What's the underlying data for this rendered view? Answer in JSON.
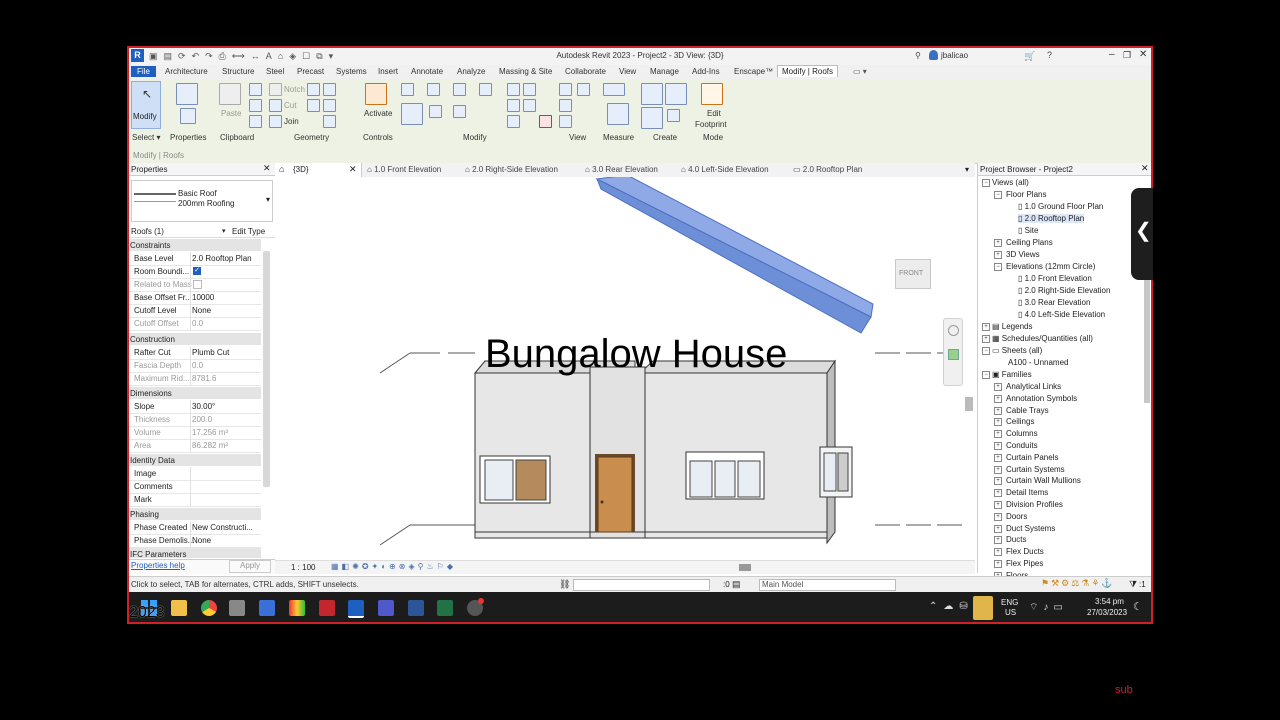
{
  "window": {
    "title": "Autodesk Revit 2023 - Project2 - 3D View: {3D}",
    "user": "jbalicao"
  },
  "menu": {
    "file": "File",
    "tabs": [
      "Architecture",
      "Structure",
      "Steel",
      "Precast",
      "Systems",
      "Insert",
      "Annotate",
      "Analyze",
      "Massing & Site",
      "Collaborate",
      "View",
      "Manage",
      "Add-Ins",
      "Enscape™",
      "Modify | Roofs"
    ]
  },
  "ribbon": {
    "modify": "Modify",
    "select": "Select ▾",
    "properties": "Properties",
    "paste": "Paste",
    "clipboard": "Clipboard",
    "notch": "Notch",
    "cut": "Cut",
    "join": "Join",
    "geometry": "Geometry",
    "activate": "Activate",
    "controls": "Controls",
    "modify_panel": "Modify",
    "view": "View",
    "measure": "Measure",
    "create": "Create",
    "edit": "Edit",
    "footprint": "Footprint",
    "mode": "Mode"
  },
  "context_bar": "Modify | Roofs",
  "properties": {
    "header": "Properties",
    "type_line1": "Basic Roof",
    "type_line2": "200mm Roofing",
    "instance": "Roofs (1)",
    "edit_type": "Edit Type",
    "groups": {
      "constraints": "Constraints",
      "construction": "Construction",
      "dimensions": "Dimensions",
      "identity": "Identity Data",
      "phasing": "Phasing",
      "ifc": "IFC Parameters"
    },
    "rows": {
      "base_level": {
        "k": "Base Level",
        "v": "2.0 Rooftop Plan"
      },
      "room_bounding": {
        "k": "Room Boundi..."
      },
      "related_mass": {
        "k": "Related to Mass"
      },
      "base_offset": {
        "k": "Base Offset Fr...",
        "v": "10000"
      },
      "cutoff_level": {
        "k": "Cutoff Level",
        "v": "None"
      },
      "cutoff_offset": {
        "k": "Cutoff Offset",
        "v": "0.0"
      },
      "rafter_cut": {
        "k": "Rafter Cut",
        "v": "Plumb Cut"
      },
      "fascia": {
        "k": "Fascia Depth",
        "v": "0.0"
      },
      "max_ridge": {
        "k": "Maximum Rid...",
        "v": "8781.6"
      },
      "slope": {
        "k": "Slope",
        "v": "30.00°"
      },
      "thickness": {
        "k": "Thickness",
        "v": "200.0"
      },
      "volume": {
        "k": "Volume",
        "v": "17.256 m³"
      },
      "area": {
        "k": "Area",
        "v": "86.282 m²"
      },
      "image": {
        "k": "Image",
        "v": ""
      },
      "comments": {
        "k": "Comments",
        "v": ""
      },
      "mark": {
        "k": "Mark",
        "v": ""
      },
      "phase_created": {
        "k": "Phase Created",
        "v": "New Constructi..."
      },
      "phase_demolished": {
        "k": "Phase Demolis...",
        "v": "None"
      }
    },
    "help": "Properties help",
    "apply": "Apply"
  },
  "view_tabs": [
    "{3D}",
    "1.0 Front Elevation",
    "2.0 Right-Side Elevation",
    "3.0 Rear Elevation",
    "4.0 Left-Side Elevation",
    "2.0 Rooftop Plan"
  ],
  "canvas": {
    "overlay_title": "Bungalow House",
    "viewcube": "FRONT",
    "scale": "1 : 100"
  },
  "project_browser": {
    "header": "Project Browser - Project2",
    "views_all": "Views (all)",
    "floor_plans": "Floor Plans",
    "fp_items": [
      "1.0 Ground Floor Plan",
      "2.0 Rooftop Plan",
      "Site"
    ],
    "ceiling_plans": "Ceiling Plans",
    "views_3d": "3D Views",
    "elevations": "Elevations (12mm Circle)",
    "elev_items": [
      "1.0 Front Elevation",
      "2.0 Right-Side Elevation",
      "3.0 Rear Elevation",
      "4.0 Left-Side Elevation"
    ],
    "legends": "Legends",
    "schedules": "Schedules/Quantities (all)",
    "sheets": "Sheets (all)",
    "sheet_item": "A100 - Unnamed",
    "families": "Families",
    "family_items": [
      "Analytical Links",
      "Annotation Symbols",
      "Cable Trays",
      "Ceilings",
      "Columns",
      "Conduits",
      "Curtain Panels",
      "Curtain Systems",
      "Curtain Wall Mullions",
      "Detail Items",
      "Division Profiles",
      "Doors",
      "Duct Systems",
      "Ducts",
      "Flex Ducts",
      "Flex Pipes",
      "Floors"
    ]
  },
  "status": {
    "hint": "Click to select, TAB for alternates, CTRL adds, SHIFT unselects.",
    "model": "Main Model",
    "zero": ":0",
    "filter": ":1"
  },
  "taskbar": {
    "lang1": "ENG",
    "lang2": "US",
    "time": "3:54 pm",
    "date": "27/03/2023",
    "overlay_year": "2023"
  },
  "watermark": "sub"
}
